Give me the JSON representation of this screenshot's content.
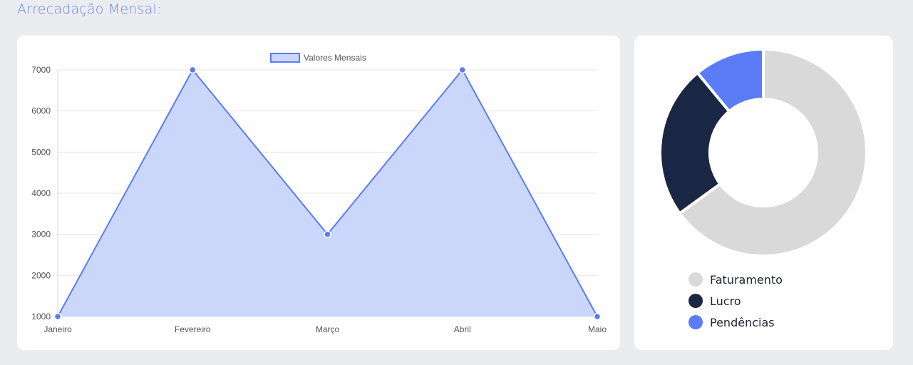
{
  "section": {
    "title": "Arrecadação Mensal:"
  },
  "colors": {
    "line": "#5b7cf7",
    "fill": "#cbd7fa",
    "faturamento": "#d9d9d9",
    "lucro": "#1a2744",
    "pendencias": "#5b7cf7"
  },
  "chart_data": [
    {
      "type": "area",
      "title": "",
      "xlabel": "",
      "ylabel": "",
      "categories": [
        "Janeiro",
        "Fevereiro",
        "Março",
        "Abril",
        "Maio"
      ],
      "series": [
        {
          "name": "Valores Mensais",
          "values": [
            1000,
            7000,
            3000,
            7000,
            1000
          ]
        }
      ],
      "ylim": [
        1000,
        7000
      ],
      "yticks": [
        1000,
        2000,
        3000,
        4000,
        5000,
        6000,
        7000
      ],
      "grid": true,
      "legend": "top-center"
    },
    {
      "type": "pie",
      "title": "",
      "categories": [
        "Faturamento",
        "Lucro",
        "Pendências"
      ],
      "values": [
        65,
        24,
        11
      ],
      "legend": "bottom"
    }
  ]
}
